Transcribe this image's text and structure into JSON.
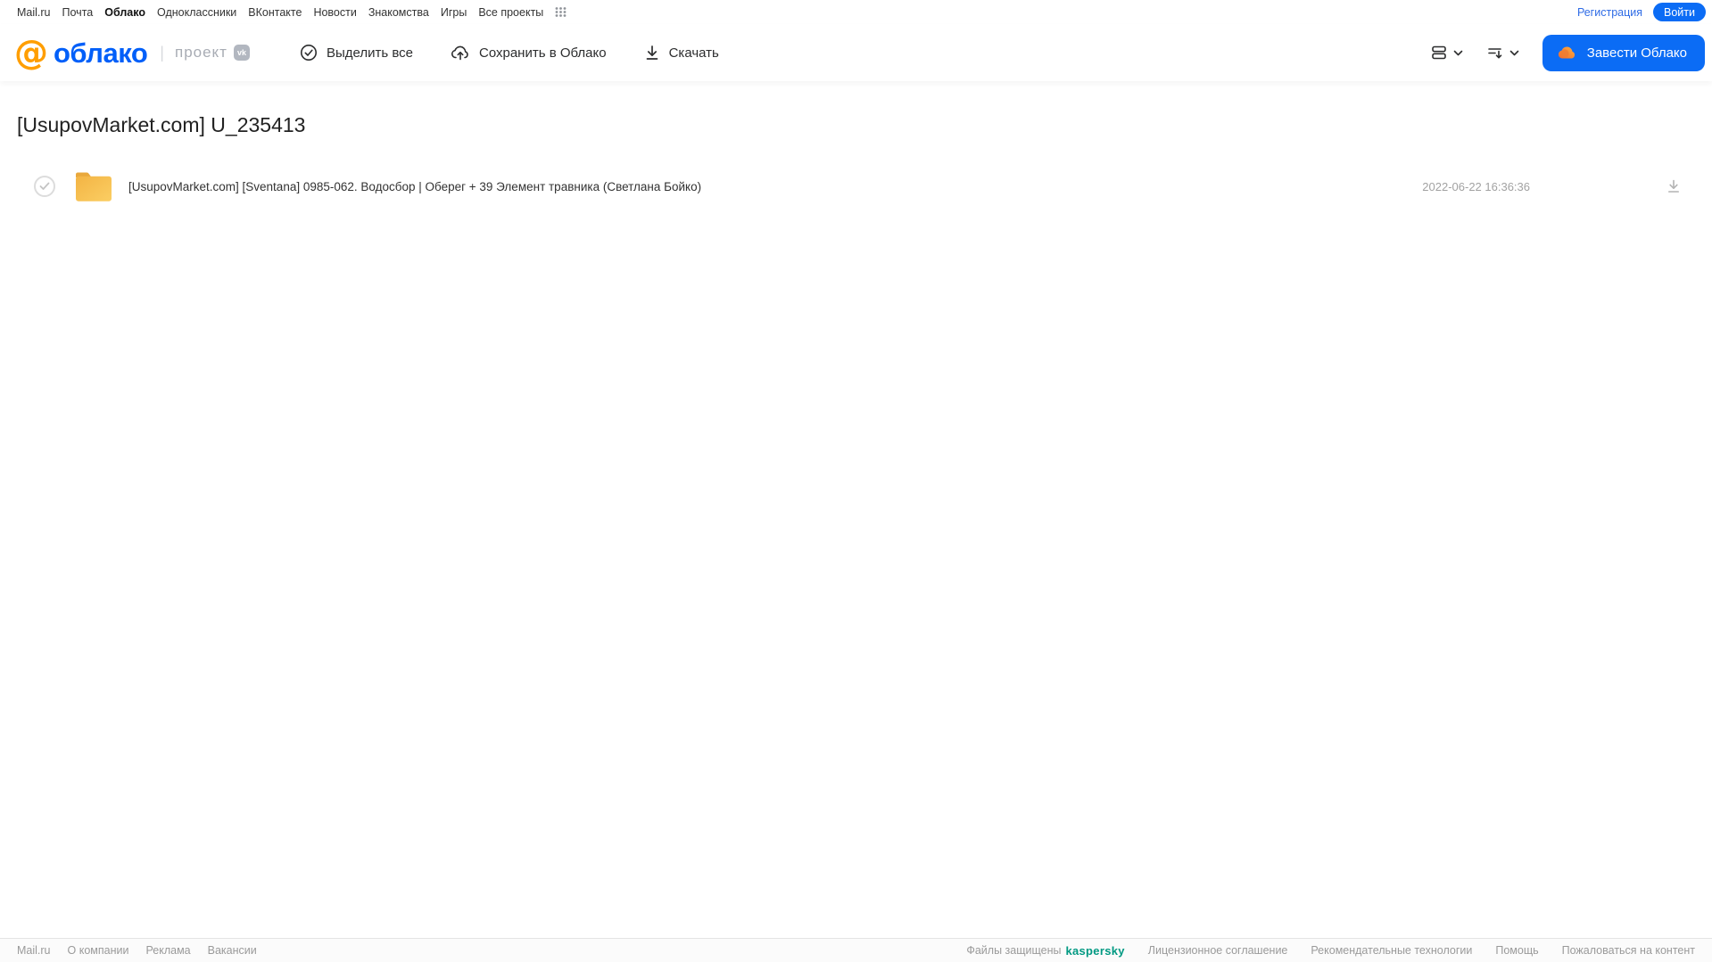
{
  "topnav": {
    "items": [
      {
        "label": "Mail.ru"
      },
      {
        "label": "Почта"
      },
      {
        "label": "Облако"
      },
      {
        "label": "Одноклассники"
      },
      {
        "label": "ВКонтакте"
      },
      {
        "label": "Новости"
      },
      {
        "label": "Знакомства"
      },
      {
        "label": "Игры"
      },
      {
        "label": "Все проекты"
      }
    ],
    "register_label": "Регистрация",
    "login_label": "Войти"
  },
  "header": {
    "logo_at": "@",
    "logo_text": "облако",
    "project_separator": "|",
    "project_label": "проект",
    "project_badge": "vk",
    "toolbar": {
      "select_all_label": "Выделить все",
      "save_to_cloud_label": "Сохранить в Облако",
      "download_label": "Скачать"
    },
    "get_cloud_label": "Завести Облако"
  },
  "main": {
    "title": "[UsupovMarket.com] U_235413",
    "files": [
      {
        "type": "folder",
        "name": "[UsupovMarket.com] [Sventana] 0985-062. Водосбор | Оберег + 39 Элемент травника (Светлана Бойко)",
        "date": "2022-06-22 16:36:36"
      }
    ]
  },
  "footer": {
    "left_links": [
      "Mail.ru",
      "О компании",
      "Реклама",
      "Вакансии"
    ],
    "protected_label": "Файлы защищены",
    "kaspersky_label": "kaspersky",
    "right_links": [
      "Лицензионное соглашение",
      "Рекомендательные технологии",
      "Помощь",
      "Пожаловаться на контент"
    ]
  },
  "colors": {
    "accent_blue": "#0b6cf5",
    "logo_blue": "#005ff9",
    "logo_orange": "#ff9e00",
    "folder_yellow": "#f6bf4c",
    "kaspersky_green": "#009982",
    "muted_gray": "#9a9a9a"
  }
}
